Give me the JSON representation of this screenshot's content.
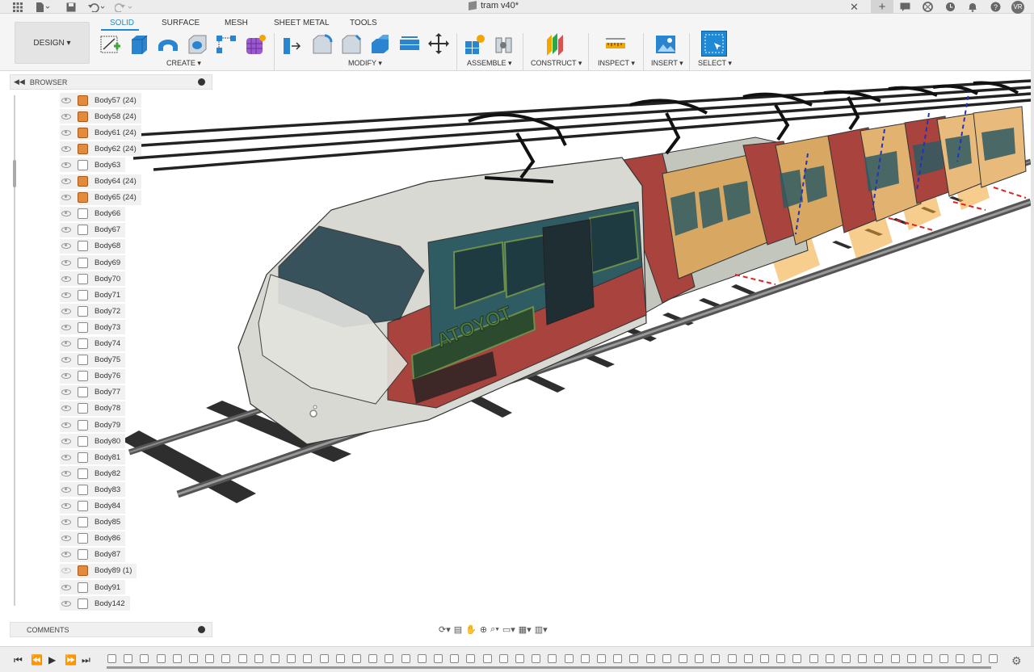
{
  "titlebar": {
    "doc_title": "tram v40*",
    "avatar": "VR",
    "icons": [
      "grid-menu-icon",
      "file-icon",
      "save-icon",
      "undo-icon",
      "redo-icon"
    ]
  },
  "workspace": {
    "label": "DESIGN ▾"
  },
  "tabs": [
    "SOLID",
    "SURFACE",
    "MESH",
    "SHEET METAL",
    "TOOLS"
  ],
  "active_tab": "SOLID",
  "groups": [
    "CREATE ▾",
    "MODIFY ▾",
    "ASSEMBLE ▾",
    "CONSTRUCT ▾",
    "INSPECT ▾",
    "INSERT ▾",
    "SELECT ▾"
  ],
  "browser": {
    "title": "BROWSER",
    "items": [
      {
        "label": "Body57 (24)",
        "type": "component"
      },
      {
        "label": "Body58 (24)",
        "type": "component"
      },
      {
        "label": "Body61 (24)",
        "type": "component"
      },
      {
        "label": "Body62 (24)",
        "type": "component"
      },
      {
        "label": "Body63",
        "type": "body"
      },
      {
        "label": "Body64 (24)",
        "type": "component"
      },
      {
        "label": "Body65 (24)",
        "type": "component"
      },
      {
        "label": "Body66",
        "type": "body"
      },
      {
        "label": "Body67",
        "type": "body"
      },
      {
        "label": "Body68",
        "type": "body"
      },
      {
        "label": "Body69",
        "type": "body"
      },
      {
        "label": "Body70",
        "type": "body"
      },
      {
        "label": "Body71",
        "type": "body"
      },
      {
        "label": "Body72",
        "type": "body"
      },
      {
        "label": "Body73",
        "type": "body"
      },
      {
        "label": "Body74",
        "type": "body"
      },
      {
        "label": "Body75",
        "type": "body"
      },
      {
        "label": "Body76",
        "type": "body"
      },
      {
        "label": "Body77",
        "type": "body"
      },
      {
        "label": "Body78",
        "type": "body"
      },
      {
        "label": "Body79",
        "type": "body"
      },
      {
        "label": "Body80",
        "type": "body"
      },
      {
        "label": "Body81",
        "type": "body"
      },
      {
        "label": "Body82",
        "type": "body"
      },
      {
        "label": "Body83",
        "type": "body"
      },
      {
        "label": "Body84",
        "type": "body"
      },
      {
        "label": "Body85",
        "type": "body"
      },
      {
        "label": "Body86",
        "type": "body"
      },
      {
        "label": "Body87",
        "type": "body"
      },
      {
        "label": "Body89 (1)",
        "type": "component",
        "hidden": true
      },
      {
        "label": "Body91",
        "type": "body"
      },
      {
        "label": "Body142",
        "type": "body"
      }
    ]
  },
  "comments": {
    "title": "COMMENTS"
  },
  "model": {
    "lettering": "TOYOTA"
  },
  "colors": {
    "accent": "#1e8ad6",
    "body_red": "#a8433e",
    "window_teal": "#2f5b63",
    "highlight_orange": "#f0a530"
  }
}
